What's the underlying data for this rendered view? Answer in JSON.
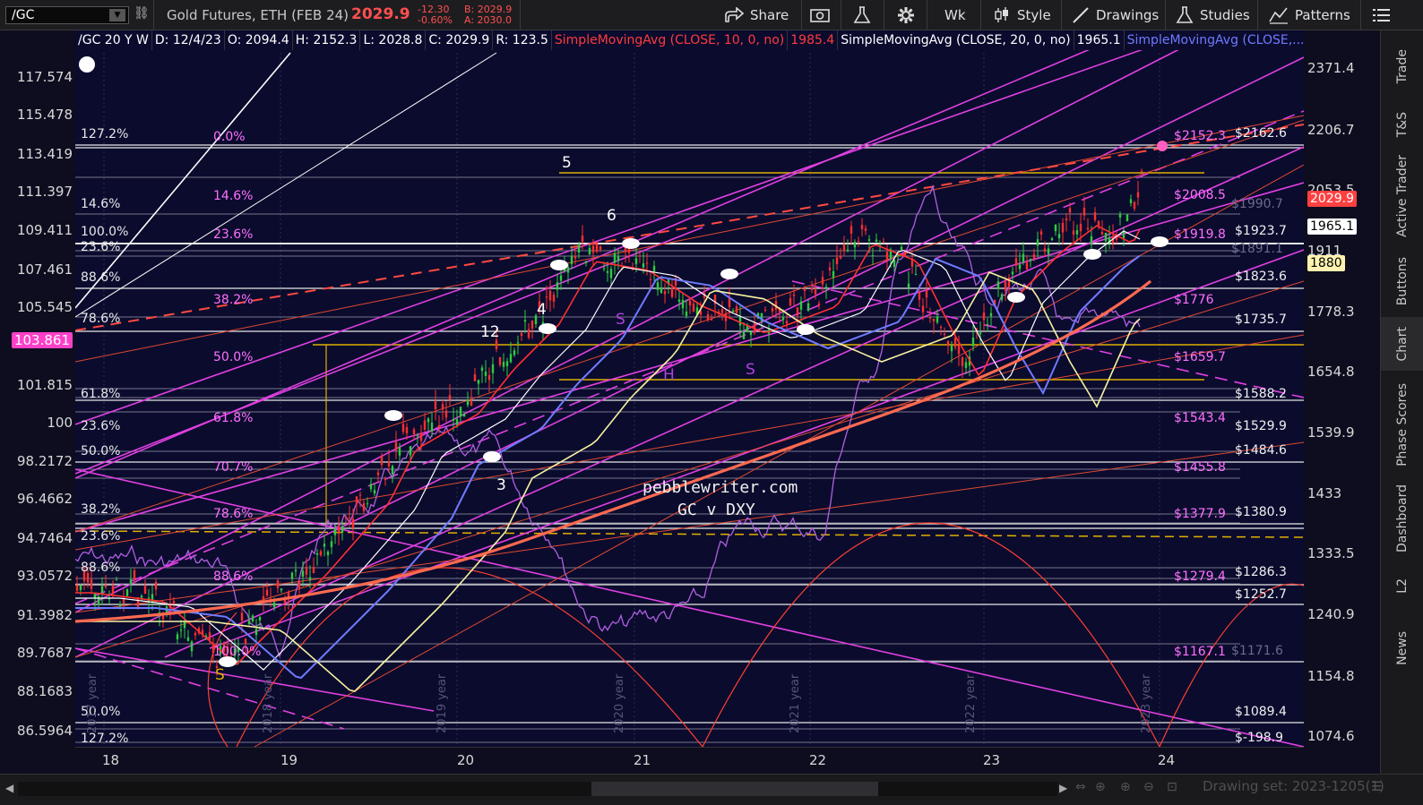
{
  "toolbar": {
    "symbol": "/GC",
    "instrument": "Gold Futures, ETH (FEB 24)",
    "last": "2029.9",
    "change": "-12.30",
    "change_pct": "-0.60%",
    "bid": "B: 2029.9",
    "ask": "A: 2030.0",
    "share_label": "Share",
    "period_label": "Wk",
    "style_label": "Style",
    "drawings_label": "Drawings",
    "studies_label": "Studies",
    "patterns_label": "Patterns"
  },
  "study_header": {
    "symbol_period": "/GC 20 Y W",
    "date": "D: 12/4/23",
    "open": "O: 2094.4",
    "high": "H: 2152.3",
    "low": "L: 2028.8",
    "close": "C: 2029.9",
    "range": "R: 123.5",
    "sma10_label": "SimpleMovingAvg (CLOSE, 10, 0, no)",
    "sma10_value": "1985.4",
    "sma20_label": "SimpleMovingAvg (CLOSE, 20, 0, no)",
    "sma20_value": "1965.1",
    "sma3_label": "SimpleMovingAvg (CLOSE,..."
  },
  "left_axis": [
    "117.574",
    "115.478",
    "113.419",
    "111.397",
    "109.411",
    "107.461",
    "105.545",
    "103.861",
    "101.815",
    "100",
    "98.2172",
    "96.4662",
    "94.7464",
    "93.0572",
    "91.3982",
    "89.7687",
    "88.1683",
    "86.5964"
  ],
  "right_axis": [
    "2371.4",
    "2206.7",
    "2053.5",
    "1911",
    "1778.3",
    "1654.8",
    "1539.9",
    "1433",
    "1333.5",
    "1240.9",
    "1154.8",
    "1074.6"
  ],
  "price_tags": {
    "last": "2029.9",
    "sma20": "1965.1",
    "sma10_level": "1880"
  },
  "x_axis": [
    "18",
    "19",
    "20",
    "21",
    "22",
    "23",
    "24"
  ],
  "year_markers": [
    "2017 year",
    "2018 year",
    "2019 year",
    "2020 year",
    "2021 year",
    "2022 year",
    "2023 year"
  ],
  "fib_left": [
    "127.2%",
    "14.6%",
    "100.0%",
    "23.6%",
    "88.6%",
    "78.6%",
    "61.8%",
    "23.6%",
    "50.0%",
    "38.2%",
    "23.6%",
    "88.6%",
    "50.0%",
    "127.2%"
  ],
  "fib_center": [
    "0.0%",
    "14.6%",
    "23.6%",
    "38.2%",
    "50.0%",
    "61.8%",
    "70.7%",
    "78.6%",
    "88.6%",
    "100.0%"
  ],
  "levels_pink": [
    "$2152.3",
    "$2008.5",
    "$1919.8",
    "$1776",
    "$1659.7",
    "$1543.4",
    "$1455.8",
    "$1377.9",
    "$1279.4",
    "$1167.1"
  ],
  "levels_white": [
    "$2162.6",
    "$1923.7",
    "$1823.6",
    "$1735.7",
    "$1588.2",
    "$1529.9",
    "$1484.6",
    "$1380.9",
    "$1286.3",
    "$1252.7",
    "$1089.4",
    "$-198.9"
  ],
  "levels_faded": [
    "$1990.7",
    "$1891.1",
    "$1171.6"
  ],
  "wave_labels": [
    "5",
    "6",
    "4",
    "12",
    "3",
    "S",
    "H",
    "S",
    "S"
  ],
  "watermark": {
    "site": "pebblewriter.com",
    "subtitle": "GC v DXY"
  },
  "sidebar_tabs": [
    "Trade",
    "T&S",
    "Active Trader",
    "Buttons",
    "Chart",
    "Phase Scores",
    "Dashboard",
    "L2",
    "News"
  ],
  "active_tab": "Chart",
  "drawing_set": "Drawing set: 2023-1205(1)"
}
